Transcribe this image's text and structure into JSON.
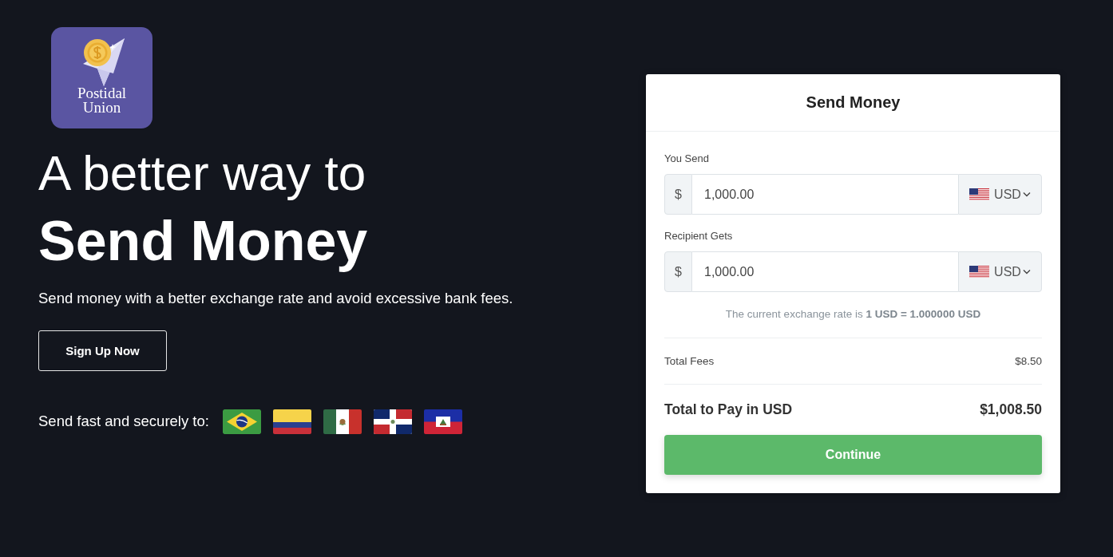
{
  "logo": {
    "name_lines": [
      "Postidal",
      "Union"
    ]
  },
  "hero": {
    "title_line1": "A better way to",
    "title_line2": "Send Money",
    "subtitle": "Send money with a better exchange rate and avoid excessive bank fees.",
    "button": "Sign Up Now"
  },
  "destinations": {
    "label": "Send fast and securely to:"
  },
  "card": {
    "title": "Send Money",
    "fields": [
      {
        "label": "You Send",
        "symbol": "$",
        "value": "1,000.00",
        "currency": "USD"
      },
      {
        "label": "Recipient Gets",
        "symbol": "$",
        "value": "1,000.00",
        "currency": "USD"
      }
    ],
    "rate_note": "The current exchange rate is **1 USD = 1.000000 USD**",
    "fees": {
      "label": "Total Fees",
      "value": "$8.50"
    },
    "total": {
      "label": "Total to Pay in USD",
      "value": "$1,008.50"
    },
    "button": "Continue"
  }
}
